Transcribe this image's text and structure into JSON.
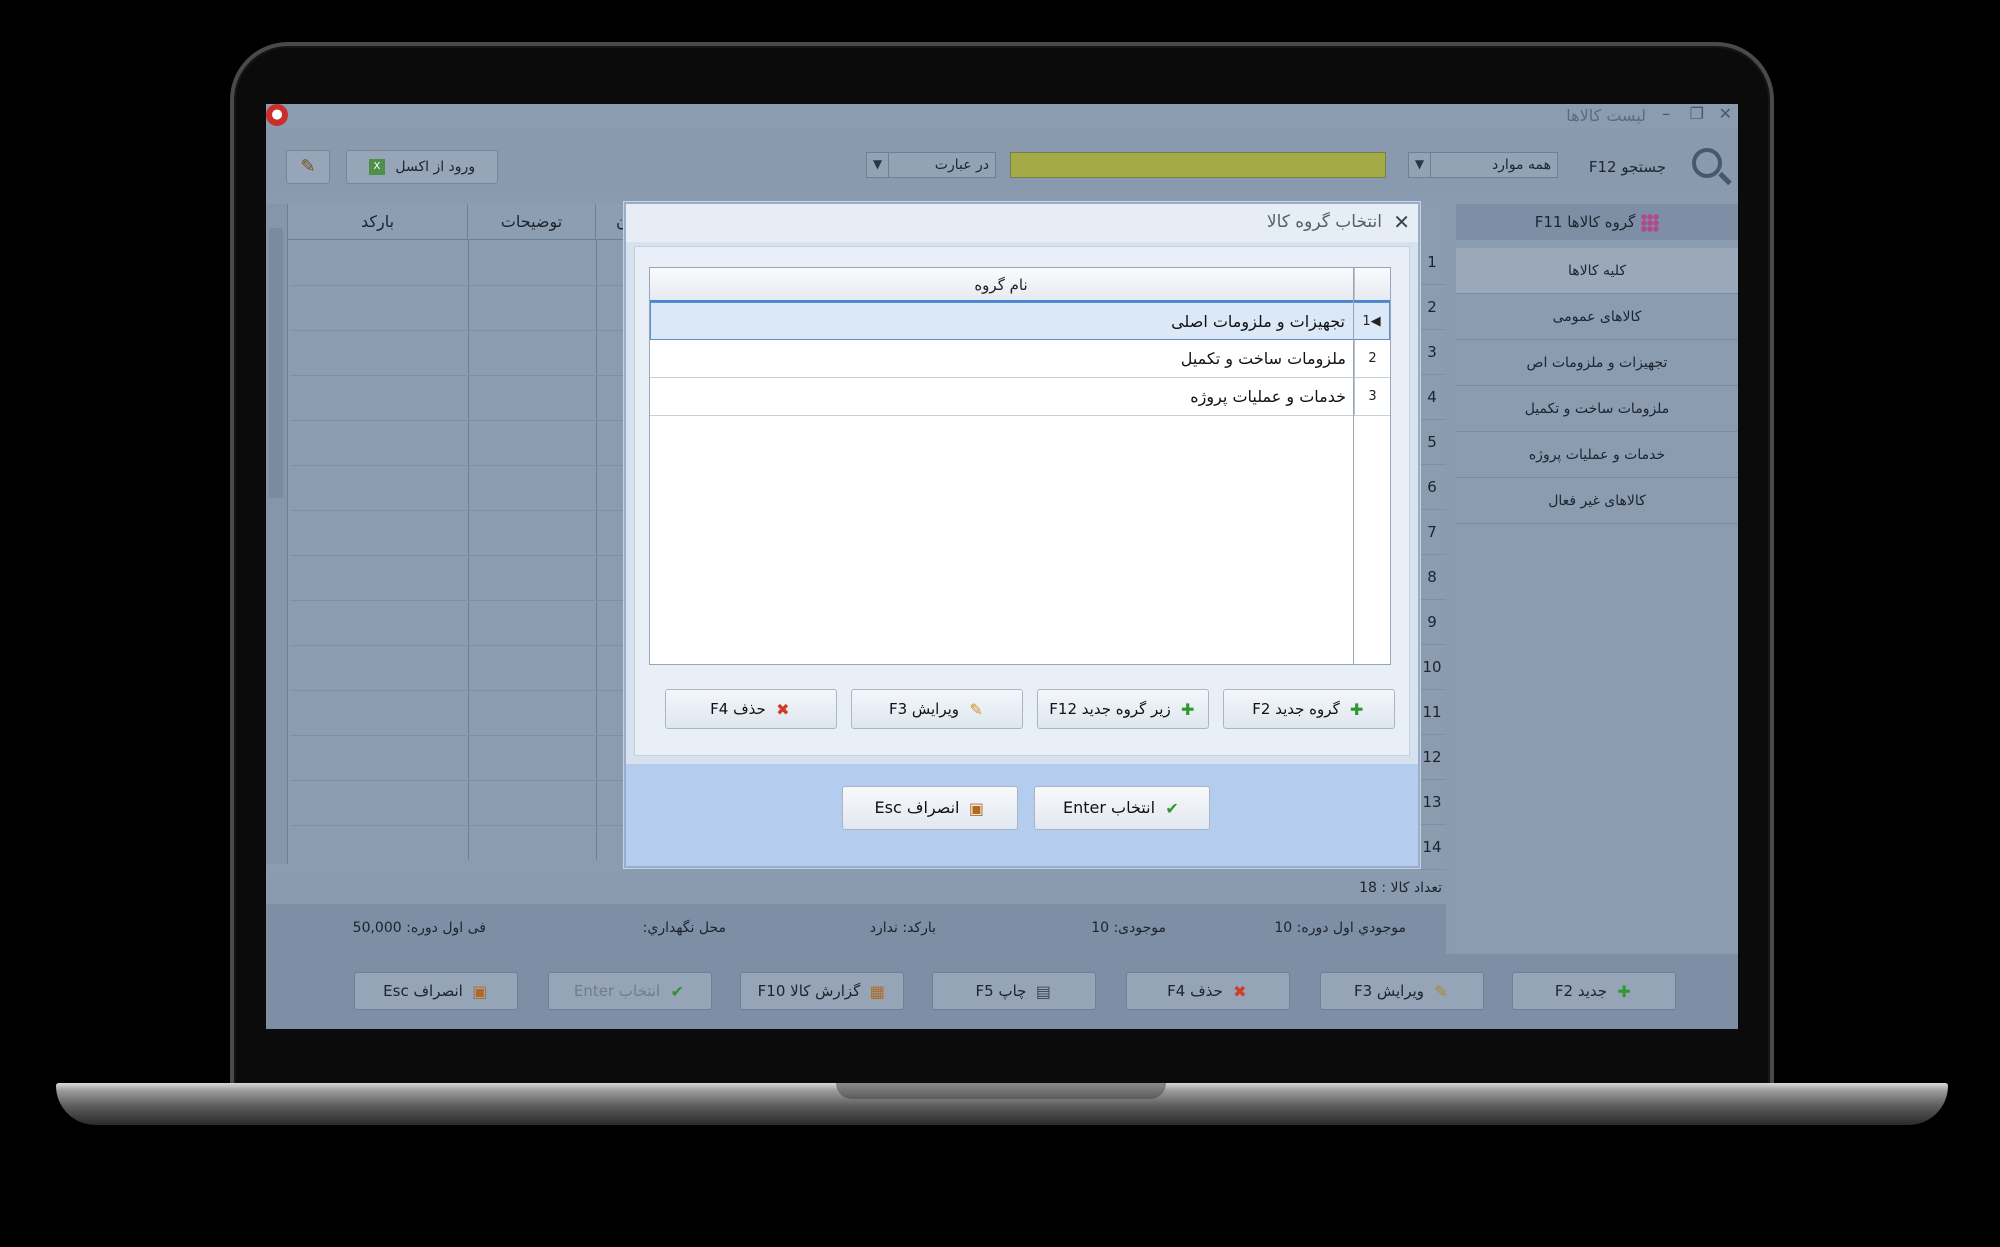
{
  "app": {
    "title": "لیست کالاها",
    "minimize": "–",
    "restore": "❐",
    "close": "✕"
  },
  "toolbar": {
    "search_label": "جستجو F12",
    "scope_value": "همه موارد",
    "mode_value": "در عبارت",
    "excel_label": "ورود از اکسل"
  },
  "sidebar": {
    "header": "گروه کالاها F11",
    "items": [
      {
        "label": "کلیه کالاها",
        "active": true
      },
      {
        "label": "کالاهای عمومی"
      },
      {
        "label": "تجهیزات و ملزومات اص"
      },
      {
        "label": "ملزومات ساخت و تکمیل"
      },
      {
        "label": "خدمات و عملیات پروژه"
      },
      {
        "label": "کالاهای غیر فعال"
      }
    ]
  },
  "grid": {
    "columns": [
      "بارکد",
      "توضیحات",
      "ن"
    ],
    "row_numbers": [
      "1",
      "2",
      "3",
      "4",
      "5",
      "6",
      "7",
      "8",
      "9",
      "10",
      "11",
      "12",
      "13",
      "14"
    ],
    "count_label": "تعداد کالا : 18"
  },
  "info_strip": {
    "opening_stock": "موجودي اول دوره: 10",
    "stock": "موجودی: 10",
    "barcode": "بارکد: ندارد",
    "storage": "محل نگهداري:",
    "opening_price": "فی اول دوره: 50,000"
  },
  "bottom_bar": {
    "new": "جدید F2",
    "edit": "ویرایش F3",
    "delete": "حذف F4",
    "print": "چاپ F5",
    "report": "گزارش کالا F10",
    "select": "انتخاب Enter",
    "cancel": "انصراف Esc"
  },
  "modal": {
    "title": "انتخاب گروه کالا",
    "column_header": "نام گروه",
    "rows": [
      {
        "num": "1",
        "name": "تجهیزات و ملزومات اصلی",
        "selected": true
      },
      {
        "num": "2",
        "name": "ملزومات ساخت و تکمیل"
      },
      {
        "num": "3",
        "name": "خدمات و عملیات پروژه"
      }
    ],
    "buttons": {
      "new_group": "گروه جدید F2",
      "new_subgroup": "زیر گروه جدید F12",
      "edit": "ویرایش F3",
      "delete": "حذف F4"
    },
    "footer": {
      "select": "انتخاب Enter",
      "cancel": "انصراف Esc"
    }
  },
  "colors": {
    "screen_bg": "#8a9bb0",
    "modal_bg": "#d8e2ef",
    "search_field": "#a4aa45",
    "selected_row": "#dbe8f7",
    "accent_green": "#2e9a2e",
    "accent_red": "#d23a2a"
  },
  "icons": {
    "search": "search-icon",
    "close": "close-icon",
    "add": "plus-icon",
    "edit": "pencil-icon",
    "delete": "x-icon",
    "print": "printer-icon",
    "report": "report-icon",
    "select": "check-icon",
    "cancel": "door-icon",
    "excel": "excel-icon",
    "brush": "brush-icon",
    "groups": "grid-icon"
  }
}
